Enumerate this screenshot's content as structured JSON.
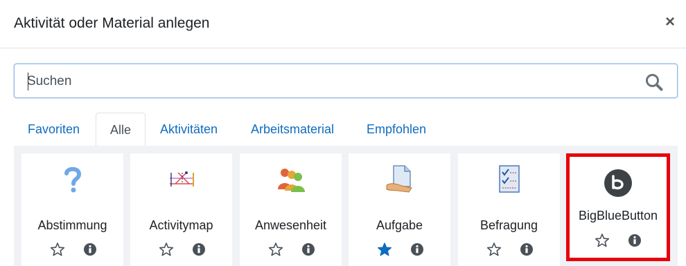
{
  "dialog": {
    "title": "Aktivität oder Material anlegen",
    "close_glyph": "×"
  },
  "search": {
    "placeholder": "Suchen",
    "value": ""
  },
  "tabs": [
    {
      "label": "Favoriten",
      "active": false
    },
    {
      "label": "Alle",
      "active": true
    },
    {
      "label": "Aktivitäten",
      "active": false
    },
    {
      "label": "Arbeitsmaterial",
      "active": false
    },
    {
      "label": "Empfohlen",
      "active": false
    }
  ],
  "modules": [
    {
      "name": "Abstimmung",
      "icon": "question-icon",
      "starred": false
    },
    {
      "name": "Activitymap",
      "icon": "activitymap-icon",
      "starred": false
    },
    {
      "name": "Anwesenheit",
      "icon": "attendance-icon",
      "starred": false
    },
    {
      "name": "Aufgabe",
      "icon": "assignment-icon",
      "starred": true
    },
    {
      "name": "Befragung",
      "icon": "survey-icon",
      "starred": false
    },
    {
      "name": "BigBlueButton",
      "icon": "bigbluebutton-icon",
      "starred": false,
      "highlighted": true
    }
  ],
  "colors": {
    "link": "#0f6cbf",
    "star_active": "#0f6cbf",
    "highlight_border": "#e8000c"
  }
}
